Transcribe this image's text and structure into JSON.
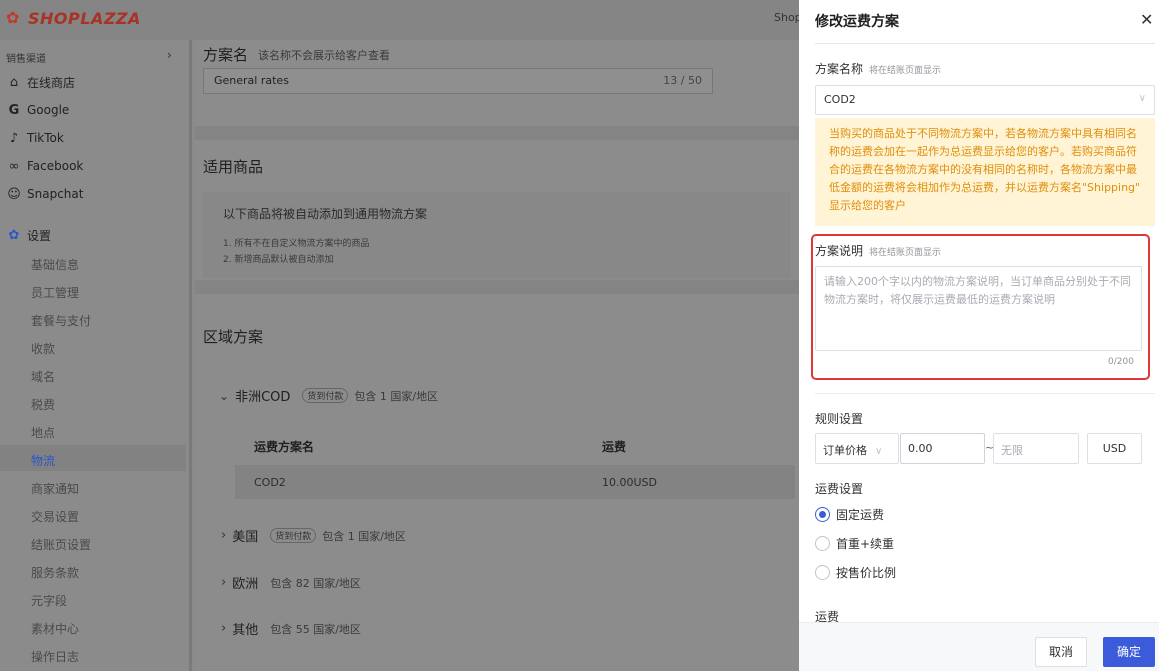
{
  "brand": {
    "logo_text": "SHOPLAZZA",
    "topbar_shop": "Shop"
  },
  "sidebar": {
    "section_label": "销售渠道",
    "channels": [
      {
        "label": "在线商店",
        "icon": "store-icon"
      },
      {
        "label": "Google",
        "icon": "google-icon"
      },
      {
        "label": "TikTok",
        "icon": "tiktok-icon"
      },
      {
        "label": "Facebook",
        "icon": "facebook-icon"
      },
      {
        "label": "Snapchat",
        "icon": "snapchat-icon"
      }
    ],
    "settings_label": "设置",
    "settings_items": [
      "基础信息",
      "员工管理",
      "套餐与支付",
      "收款",
      "域名",
      "税费",
      "地点",
      "物流",
      "商家通知",
      "交易设置",
      "结账页设置",
      "服务条款",
      "元字段",
      "素材中心",
      "操作日志"
    ],
    "active_item": "物流"
  },
  "main": {
    "plan_name_title": "方案名",
    "plan_name_hint": "该名称不会展示给客户查看",
    "plan_name_value": "General rates",
    "plan_name_count": "13 / 50",
    "products_title": "适用商品",
    "products_note": "以下商品将被自动添加到通用物流方案",
    "products_rule_1": "1. 所有不在自定义物流方案中的商品",
    "products_rule_2": "2. 新增商品默认被自动添加",
    "zones_title": "区域方案",
    "zones": [
      {
        "name": "非洲COD",
        "badge": "货到付款",
        "count": "包含 1 国家/地区",
        "expanded": true
      },
      {
        "name": "美国",
        "badge": "货到付款",
        "count": "包含 1 国家/地区",
        "expanded": false
      },
      {
        "name": "欧洲",
        "badge": "",
        "count": "包含 82 国家/地区",
        "expanded": false
      },
      {
        "name": "其他",
        "badge": "",
        "count": "包含 55 国家/地区",
        "expanded": false
      }
    ],
    "table": {
      "col_name": "运费方案名",
      "col_fee": "运费",
      "row_name": "COD2",
      "row_fee": "10.00USD"
    }
  },
  "drawer": {
    "title": "修改运费方案",
    "scheme_name_label": "方案名称",
    "scheme_name_hint": "将在结账页面显示",
    "scheme_name_value": "COD2",
    "notice_text": "当购买的商品处于不同物流方案中，若各物流方案中具有相同名称的运费会加在一起作为总运费显示给您的客户。若购买商品符合的运费在各物流方案中的没有相同的名称时，各物流方案中最低金额的运费将会相加作为总运费，并以运费方案名\"Shipping\" 显示给您的客户",
    "desc_label": "方案说明",
    "desc_hint": "将在结账页面显示",
    "desc_placeholder": "请输入200个字以内的物流方案说明，当订单商品分别处于不同物流方案时，将仅展示运费最低的运费方案说明",
    "desc_count": "0/200",
    "rules_label": "规则设置",
    "rule_type": "订单价格",
    "rule_min": "0.00",
    "rule_max_placeholder": "无限",
    "rule_currency": "USD",
    "fee_setting_label": "运费设置",
    "fee_options": [
      "固定运费",
      "首重+续重",
      "按售价比例"
    ],
    "fee_selected": "固定运费",
    "fee_label": "运费",
    "cancel_label": "取消",
    "confirm_label": "确定"
  },
  "colors": {
    "primary": "#3b5bdb",
    "highlight_border": "#e03636",
    "notice_bg": "#fff4d6",
    "notice_text": "#e08e0b"
  }
}
